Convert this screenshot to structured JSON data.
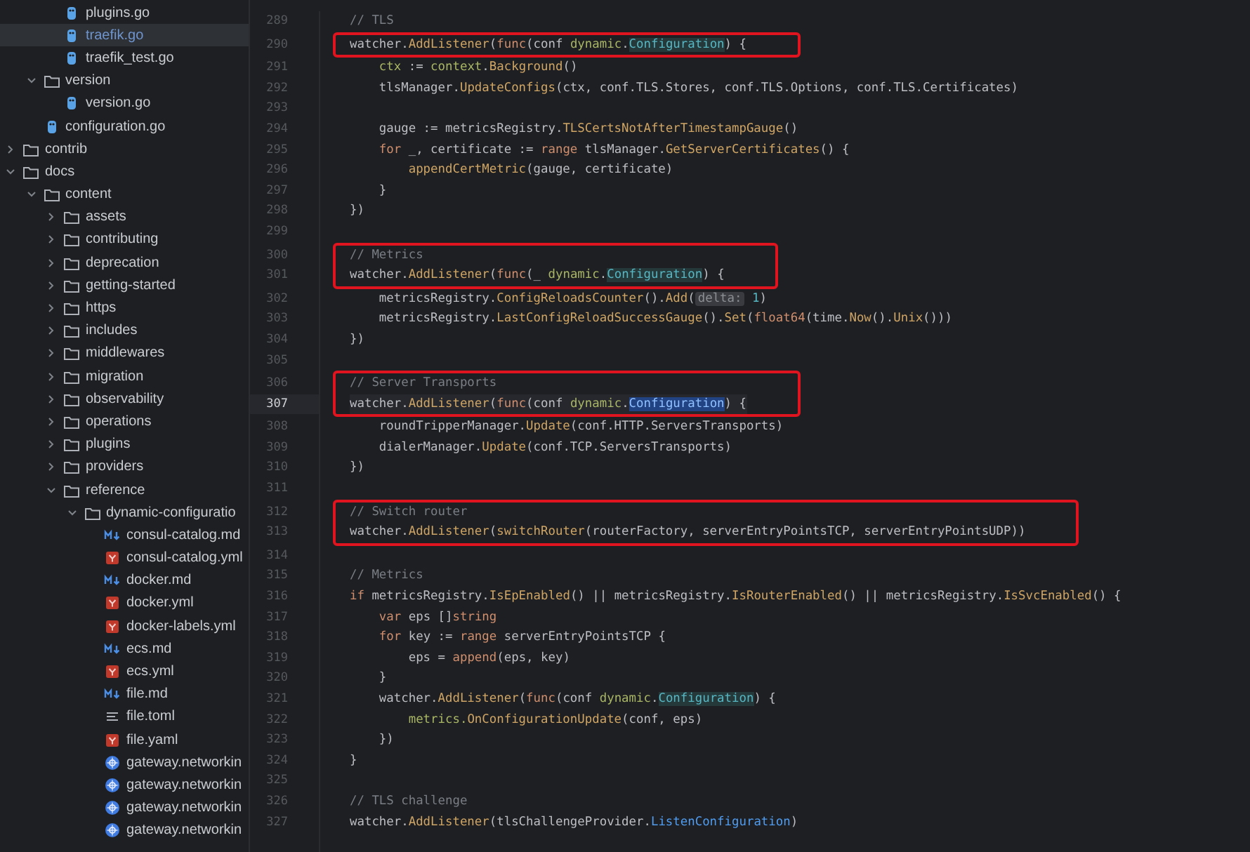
{
  "project_tree": [
    {
      "children": [
        {
          "children": [
            {
              "label": "plugins.go",
              "kind": "go",
              "selected": false
            },
            {
              "label": "traefik.go",
              "kind": "go",
              "selected": true
            },
            {
              "label": "traefik_test.go",
              "kind": "go",
              "selected": false
            }
          ]
        },
        {
          "label": "version",
          "kind": "folder",
          "expanded": true,
          "selected": false,
          "children": [
            {
              "label": "version.go",
              "kind": "go",
              "selected": false
            }
          ]
        },
        {
          "label": "configuration.go",
          "kind": "go",
          "selected": false
        }
      ]
    },
    {
      "label": "contrib",
      "kind": "folder",
      "expanded": false,
      "selected": false
    },
    {
      "label": "docs",
      "kind": "folder",
      "expanded": true,
      "selected": false,
      "children": [
        {
          "label": "content",
          "kind": "folder",
          "expanded": true,
          "selected": false,
          "children": [
            {
              "label": "assets",
              "kind": "folder",
              "expanded": false,
              "selected": false
            },
            {
              "label": "contributing",
              "kind": "folder",
              "expanded": false,
              "selected": false
            },
            {
              "label": "deprecation",
              "kind": "folder",
              "expanded": false,
              "selected": false
            },
            {
              "label": "getting-started",
              "kind": "folder",
              "expanded": false,
              "selected": false
            },
            {
              "label": "https",
              "kind": "folder",
              "expanded": false,
              "selected": false
            },
            {
              "label": "includes",
              "kind": "folder",
              "expanded": false,
              "selected": false
            },
            {
              "label": "middlewares",
              "kind": "folder",
              "expanded": false,
              "selected": false
            },
            {
              "label": "migration",
              "kind": "folder",
              "expanded": false,
              "selected": false
            },
            {
              "label": "observability",
              "kind": "folder",
              "expanded": false,
              "selected": false
            },
            {
              "label": "operations",
              "kind": "folder",
              "expanded": false,
              "selected": false
            },
            {
              "label": "plugins",
              "kind": "folder",
              "expanded": false,
              "selected": false
            },
            {
              "label": "providers",
              "kind": "folder",
              "expanded": false,
              "selected": false
            },
            {
              "label": "reference",
              "kind": "folder",
              "expanded": true,
              "selected": false,
              "children": [
                {
                  "label": "dynamic-configuratio",
                  "kind": "folder",
                  "expanded": true,
                  "selected": false,
                  "children": [
                    {
                      "label": "consul-catalog.md",
                      "kind": "md",
                      "selected": false
                    },
                    {
                      "label": "consul-catalog.yml",
                      "kind": "yml",
                      "selected": false
                    },
                    {
                      "label": "docker.md",
                      "kind": "md",
                      "selected": false
                    },
                    {
                      "label": "docker.yml",
                      "kind": "yml",
                      "selected": false
                    },
                    {
                      "label": "docker-labels.yml",
                      "kind": "yml",
                      "selected": false
                    },
                    {
                      "label": "ecs.md",
                      "kind": "md",
                      "selected": false
                    },
                    {
                      "label": "ecs.yml",
                      "kind": "yml",
                      "selected": false
                    },
                    {
                      "label": "file.md",
                      "kind": "md",
                      "selected": false
                    },
                    {
                      "label": "file.toml",
                      "kind": "toml",
                      "selected": false
                    },
                    {
                      "label": "file.yaml",
                      "kind": "yml",
                      "selected": false
                    },
                    {
                      "label": "gateway.networkin",
                      "kind": "k8s",
                      "selected": false
                    },
                    {
                      "label": "gateway.networkin",
                      "kind": "k8s",
                      "selected": false
                    },
                    {
                      "label": "gateway.networkin",
                      "kind": "k8s",
                      "selected": false
                    },
                    {
                      "label": "gateway.networkin",
                      "kind": "k8s",
                      "selected": false
                    }
                  ]
                }
              ]
            }
          ]
        }
      ]
    }
  ],
  "editor": {
    "lines": [
      {
        "number": "289",
        "boxed": false,
        "current": false,
        "tokens": [
          {
            "kind": "comment",
            "text": "// TLS"
          }
        ]
      },
      {
        "number": "290",
        "boxed": true,
        "current": false,
        "tokens": [
          {
            "kind": "plain",
            "text": "watcher."
          },
          {
            "kind": "fn",
            "text": "AddListener"
          },
          {
            "kind": "plain",
            "text": "("
          },
          {
            "kind": "kw",
            "text": "func"
          },
          {
            "kind": "plain",
            "text": "(conf "
          },
          {
            "kind": "pkg",
            "text": "dynamic"
          },
          {
            "kind": "plain",
            "text": "."
          },
          {
            "kind": "type",
            "text": "Configuration"
          },
          {
            "kind": "plain",
            "text": ") {"
          }
        ]
      },
      {
        "number": "291",
        "boxed": false,
        "current": false,
        "tokens": [
          {
            "kind": "pkg",
            "text": "    ctx"
          },
          {
            "kind": "plain",
            "text": " := "
          },
          {
            "kind": "pkg",
            "text": "context"
          },
          {
            "kind": "plain",
            "text": "."
          },
          {
            "kind": "fn",
            "text": "Background"
          },
          {
            "kind": "plain",
            "text": "()"
          }
        ]
      },
      {
        "number": "292",
        "boxed": false,
        "current": false,
        "tokens": [
          {
            "kind": "plain",
            "text": "    tlsManager."
          },
          {
            "kind": "fn",
            "text": "UpdateConfigs"
          },
          {
            "kind": "plain",
            "text": "(ctx, conf.TLS.Stores, conf.TLS.Options, conf.TLS.Certificates)"
          }
        ]
      },
      {
        "number": "293",
        "boxed": false,
        "current": false
      },
      {
        "number": "294",
        "boxed": false,
        "current": false,
        "tokens": [
          {
            "kind": "plain",
            "text": "    gauge := metricsRegistry."
          },
          {
            "kind": "fn",
            "text": "TLSCertsNotAfterTimestampGauge"
          },
          {
            "kind": "plain",
            "text": "()"
          }
        ]
      },
      {
        "number": "295",
        "boxed": false,
        "current": false,
        "tokens": [
          {
            "kind": "kw",
            "text": "    for"
          },
          {
            "kind": "plain",
            "text": " _, certificate := "
          },
          {
            "kind": "kw",
            "text": "range"
          },
          {
            "kind": "plain",
            "text": " tlsManager."
          },
          {
            "kind": "fn",
            "text": "GetServerCertificates"
          },
          {
            "kind": "plain",
            "text": "() {"
          }
        ]
      },
      {
        "number": "296",
        "boxed": false,
        "current": false,
        "tokens": [
          {
            "kind": "fn",
            "text": "        appendCertMetric"
          },
          {
            "kind": "plain",
            "text": "(gauge, certificate)"
          }
        ]
      },
      {
        "number": "297",
        "boxed": false,
        "current": false,
        "tokens": [
          {
            "kind": "plain",
            "text": "    }"
          }
        ]
      },
      {
        "number": "298",
        "boxed": false,
        "current": false,
        "tokens": [
          {
            "kind": "plain",
            "text": "})"
          }
        ]
      },
      {
        "number": "299",
        "boxed": false,
        "current": false
      },
      {
        "number": "300",
        "boxed": true,
        "current": false,
        "tokens": [
          {
            "kind": "comment",
            "text": "// Metrics"
          }
        ]
      },
      {
        "number": "301",
        "boxed": true,
        "current": false,
        "tokens": [
          {
            "kind": "plain",
            "text": "watcher."
          },
          {
            "kind": "fn",
            "text": "AddListener"
          },
          {
            "kind": "plain",
            "text": "("
          },
          {
            "kind": "kw",
            "text": "func"
          },
          {
            "kind": "plain",
            "text": "(_ "
          },
          {
            "kind": "pkg",
            "text": "dynamic"
          },
          {
            "kind": "plain",
            "text": "."
          },
          {
            "kind": "type",
            "text": "Configuration"
          },
          {
            "kind": "plain",
            "text": ") {"
          }
        ]
      },
      {
        "number": "302",
        "boxed": false,
        "current": false,
        "tokens": [
          {
            "kind": "plain",
            "text": "    metricsRegistry."
          },
          {
            "kind": "fn",
            "text": "ConfigReloadsCounter"
          },
          {
            "kind": "plain",
            "text": "()."
          },
          {
            "kind": "fn",
            "text": "Add"
          },
          {
            "kind": "plain",
            "text": "("
          },
          {
            "kind": "hint",
            "text": "delta:"
          },
          {
            "kind": "num",
            "text": " 1"
          },
          {
            "kind": "plain",
            "text": ")"
          }
        ]
      },
      {
        "number": "303",
        "boxed": false,
        "current": false,
        "tokens": [
          {
            "kind": "plain",
            "text": "    metricsRegistry."
          },
          {
            "kind": "fn",
            "text": "LastConfigReloadSuccessGauge"
          },
          {
            "kind": "plain",
            "text": "()."
          },
          {
            "kind": "fn",
            "text": "Set"
          },
          {
            "kind": "plain",
            "text": "("
          },
          {
            "kind": "kw",
            "text": "float64"
          },
          {
            "kind": "plain",
            "text": "(time."
          },
          {
            "kind": "fn",
            "text": "Now"
          },
          {
            "kind": "plain",
            "text": "()."
          },
          {
            "kind": "fn",
            "text": "Unix"
          },
          {
            "kind": "plain",
            "text": "()))"
          }
        ]
      },
      {
        "number": "304",
        "boxed": false,
        "current": false,
        "tokens": [
          {
            "kind": "plain",
            "text": "})"
          }
        ]
      },
      {
        "number": "305",
        "boxed": false,
        "current": false
      },
      {
        "number": "306",
        "boxed": true,
        "current": false,
        "tokens": [
          {
            "kind": "comment",
            "text": "// Server Transports"
          }
        ]
      },
      {
        "number": "307",
        "boxed": true,
        "current": true,
        "tokens": [
          {
            "kind": "plain",
            "text": "watcher."
          },
          {
            "kind": "fn",
            "text": "AddListener"
          },
          {
            "kind": "plain",
            "text": "("
          },
          {
            "kind": "kw",
            "text": "func"
          },
          {
            "kind": "plain",
            "text": "(conf "
          },
          {
            "kind": "pkg",
            "text": "dynamic"
          },
          {
            "kind": "plain",
            "text": "."
          },
          {
            "kind": "match",
            "text": "Configuration"
          },
          {
            "kind": "plain",
            "text": ") {"
          }
        ]
      },
      {
        "number": "308",
        "boxed": false,
        "current": false,
        "tokens": [
          {
            "kind": "plain",
            "text": "    roundTripperManager."
          },
          {
            "kind": "fn",
            "text": "Update"
          },
          {
            "kind": "plain",
            "text": "(conf.HTTP.ServersTransports)"
          }
        ]
      },
      {
        "number": "309",
        "boxed": false,
        "current": false,
        "tokens": [
          {
            "kind": "plain",
            "text": "    dialerManager."
          },
          {
            "kind": "fn",
            "text": "Update"
          },
          {
            "kind": "plain",
            "text": "(conf.TCP.ServersTransports)"
          }
        ]
      },
      {
        "number": "310",
        "boxed": false,
        "current": false,
        "tokens": [
          {
            "kind": "plain",
            "text": "})"
          }
        ]
      },
      {
        "number": "311",
        "boxed": false,
        "current": false
      },
      {
        "number": "312",
        "boxed": true,
        "current": false,
        "tokens": [
          {
            "kind": "comment",
            "text": "// Switch router"
          }
        ]
      },
      {
        "number": "313",
        "boxed": true,
        "current": false,
        "tokens": [
          {
            "kind": "plain",
            "text": "watcher."
          },
          {
            "kind": "fn",
            "text": "AddListener"
          },
          {
            "kind": "plain",
            "text": "("
          },
          {
            "kind": "fn",
            "text": "switchRouter"
          },
          {
            "kind": "plain",
            "text": "(routerFactory, serverEntryPointsTCP, serverEntryPointsUDP))"
          }
        ]
      },
      {
        "number": "314",
        "boxed": false,
        "current": false
      },
      {
        "number": "315",
        "boxed": false,
        "current": false,
        "tokens": [
          {
            "kind": "comment",
            "text": "// Metrics"
          }
        ]
      },
      {
        "number": "316",
        "boxed": false,
        "current": false,
        "tokens": [
          {
            "kind": "kw",
            "text": "if"
          },
          {
            "kind": "plain",
            "text": " metricsRegistry."
          },
          {
            "kind": "fn",
            "text": "IsEpEnabled"
          },
          {
            "kind": "plain",
            "text": "() || metricsRegistry."
          },
          {
            "kind": "fn",
            "text": "IsRouterEnabled"
          },
          {
            "kind": "plain",
            "text": "() || metricsRegistry."
          },
          {
            "kind": "fn",
            "text": "IsSvcEnabled"
          },
          {
            "kind": "plain",
            "text": "() {"
          }
        ]
      },
      {
        "number": "317",
        "boxed": false,
        "current": false,
        "tokens": [
          {
            "kind": "kw",
            "text": "    var"
          },
          {
            "kind": "plain",
            "text": " eps []"
          },
          {
            "kind": "kw",
            "text": "string"
          }
        ]
      },
      {
        "number": "318",
        "boxed": false,
        "current": false,
        "tokens": [
          {
            "kind": "kw",
            "text": "    for"
          },
          {
            "kind": "plain",
            "text": " key := "
          },
          {
            "kind": "kw",
            "text": "range"
          },
          {
            "kind": "plain",
            "text": " serverEntryPointsTCP {"
          }
        ]
      },
      {
        "number": "319",
        "boxed": false,
        "current": false,
        "tokens": [
          {
            "kind": "plain",
            "text": "        eps = "
          },
          {
            "kind": "kw",
            "text": "append"
          },
          {
            "kind": "plain",
            "text": "(eps, key)"
          }
        ]
      },
      {
        "number": "320",
        "boxed": false,
        "current": false,
        "tokens": [
          {
            "kind": "plain",
            "text": "    }"
          }
        ]
      },
      {
        "number": "321",
        "boxed": false,
        "current": false,
        "tokens": [
          {
            "kind": "plain",
            "text": "    watcher."
          },
          {
            "kind": "fn",
            "text": "AddListener"
          },
          {
            "kind": "plain",
            "text": "("
          },
          {
            "kind": "kw",
            "text": "func"
          },
          {
            "kind": "plain",
            "text": "(conf "
          },
          {
            "kind": "pkg",
            "text": "dynamic"
          },
          {
            "kind": "plain",
            "text": "."
          },
          {
            "kind": "type",
            "text": "Configuration"
          },
          {
            "kind": "plain",
            "text": ") {"
          }
        ]
      },
      {
        "number": "322",
        "boxed": false,
        "current": false,
        "tokens": [
          {
            "kind": "pkg",
            "text": "        metrics."
          },
          {
            "kind": "fn",
            "text": "OnConfigurationUpdate"
          },
          {
            "kind": "plain",
            "text": "(conf, eps)"
          }
        ]
      },
      {
        "number": "323",
        "boxed": false,
        "current": false,
        "tokens": [
          {
            "kind": "plain",
            "text": "    })"
          }
        ]
      },
      {
        "number": "324",
        "boxed": false,
        "current": false,
        "tokens": [
          {
            "kind": "plain",
            "text": "}"
          }
        ]
      },
      {
        "number": "325",
        "boxed": false,
        "current": false
      },
      {
        "number": "326",
        "boxed": false,
        "current": false,
        "tokens": [
          {
            "kind": "comment",
            "text": "// TLS challenge"
          }
        ]
      },
      {
        "number": "327",
        "boxed": false,
        "current": false,
        "tokens": [
          {
            "kind": "plain",
            "text": "watcher."
          },
          {
            "kind": "fn",
            "text": "AddListener"
          },
          {
            "kind": "plain",
            "text": "(tlsChallengeProvider."
          },
          {
            "kind": "call",
            "text": "ListenConfiguration"
          },
          {
            "kind": "plain",
            "text": ")"
          }
        ]
      }
    ]
  }
}
